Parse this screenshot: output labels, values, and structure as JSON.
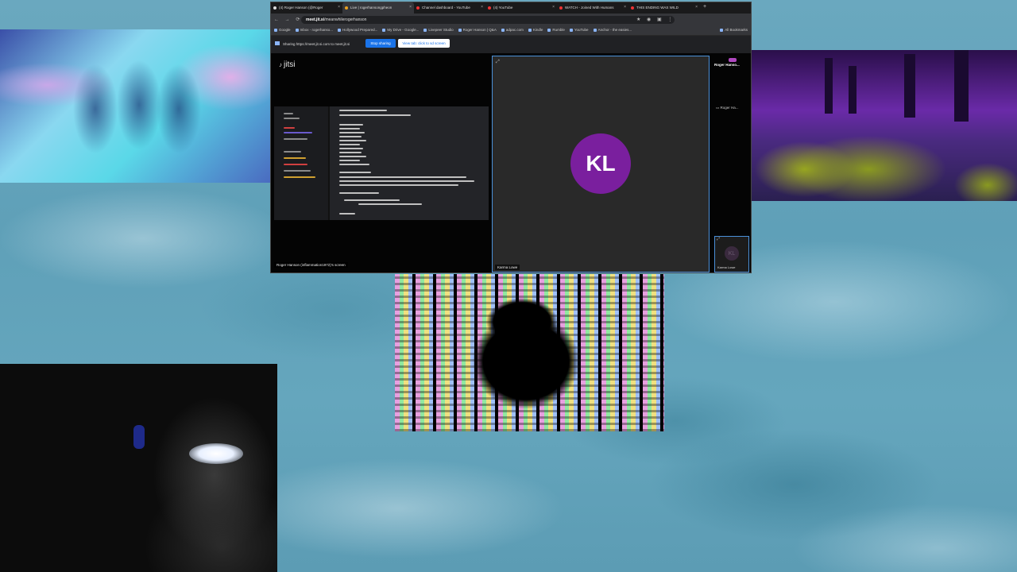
{
  "browser": {
    "tabs": [
      {
        "label": "(4) Roger Hanson (@Roger",
        "active": false
      },
      {
        "label": "Live | rogerhansongpheon",
        "active": true
      },
      {
        "label": "Channel dashboard - YouTube",
        "active": false
      },
      {
        "label": "(4) YouTube",
        "active": false
      },
      {
        "label": "WATCH - Joined With Humans",
        "active": false
      },
      {
        "label": "THIS ENDING WAS WILD",
        "active": false
      }
    ],
    "new_tab": "+",
    "url_host": "meet.jit.si",
    "url_path": "/meanwhilerogerhanson",
    "bookmarks": [
      "Google",
      "Inbox - rogerhanso...",
      "Hollywood Prepared...",
      "My Drive - Google...",
      "Livepeer Studio",
      "Roger Hanson | Q&A",
      "adpac.com",
      "Kindle",
      "Rumble",
      "YouTube",
      "Anchor - the easies..."
    ],
    "all_bookmarks": "All Bookmarks",
    "share_text": "Sharing https://meet.jit.si.com to meet.jit.si",
    "stop_sharing": "Stop sharing",
    "switch_tab": "View tab: click to sd screen"
  },
  "jitsi": {
    "logo": "jitsi",
    "presenter_caption": "Roger Hanson (inflammation1972)'s screen",
    "main_avatar_initials": "KL",
    "main_tile_name": "Karma Lowe",
    "filmstrip": {
      "participant1": "Roger Hanso...",
      "participant2": "Roger Ha...",
      "thumb_initials": "KL",
      "thumb_name": "Karma Lowe"
    }
  },
  "colors": {
    "avatar_main": "#7a1f9e",
    "active_border": "#4a90d9",
    "stop_sharing": "#1a73e8"
  }
}
